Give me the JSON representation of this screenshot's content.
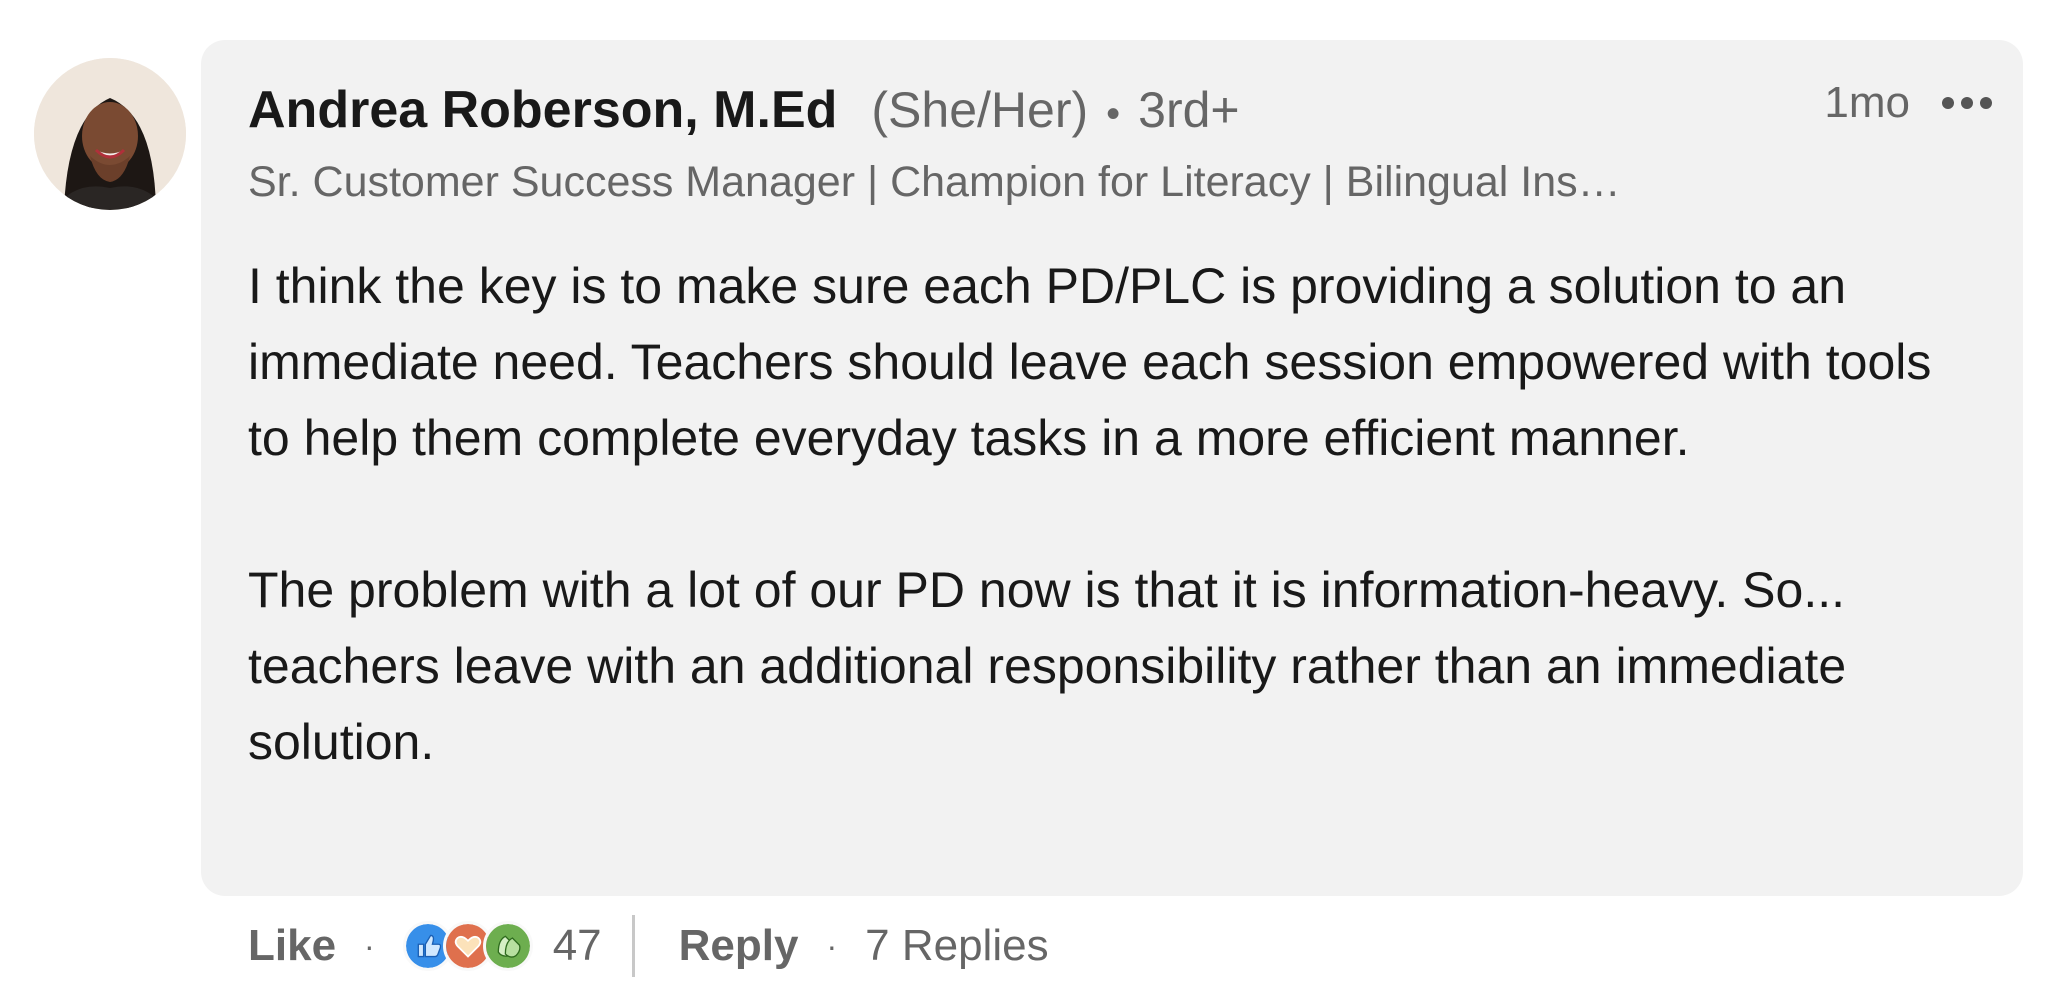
{
  "comment": {
    "author": {
      "name": "Andrea Roberson, M.Ed",
      "pronouns": "(She/Her)",
      "connection": "3rd+",
      "headline": "Sr. Customer Success Manager | Champion for Literacy | Bilingual Ins…",
      "avatar": "avatar-photo"
    },
    "timestamp": "1mo",
    "more_icon": "ellipsis-icon",
    "paragraphs": [
      "I think the key is to make sure each PD/PLC is providing a solution to an immediate need. Teachers should leave each session empowered with tools to help them complete everyday tasks in a more efficient manner.",
      "The problem with a lot of our PD now is that it is information-heavy. So... teachers leave with an additional responsibility rather than an immediate solution."
    ],
    "actions": {
      "like_label": "Like",
      "reply_label": "Reply",
      "reaction_icons": [
        "like-icon",
        "love-icon",
        "celebrate-icon"
      ],
      "reaction_count": "47",
      "replies_label": "7 Replies"
    }
  },
  "colors": {
    "bubble_background": "#f2f2f2",
    "primary_text": "#191919",
    "secondary_text": "#666666",
    "like_blue": "#378fe9",
    "love_red": "#df704d",
    "celebrate_green": "#6dae4f"
  }
}
